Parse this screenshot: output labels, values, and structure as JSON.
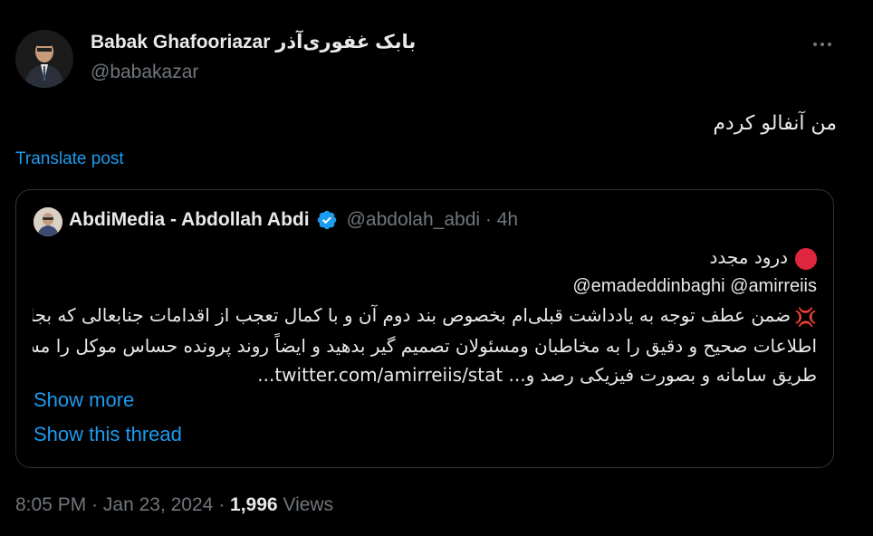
{
  "tweet": {
    "author_name": "Babak Ghafooriazar بابک غفوری‌آذر",
    "author_handle": "@babakazar",
    "text": "من آنفالو کردم",
    "translate_label": "Translate post",
    "time": "8:05 PM",
    "date": "Jan 23, 2024",
    "views_count": "1,996",
    "views_label": "Views",
    "separator": "·"
  },
  "quote": {
    "author_name": "AbdiMedia - Abdollah Abdi",
    "author_handle": "@abdolah_abdi",
    "age": "4h",
    "lines": [
      "درود مجدد",
      "@emadeddinbaghi @amirreiis",
      "ضمن عطف توجه به یادداشت قبلی‌ام بخصوص بند دوم آن و با کمال تعجب از اقدامات جنابعالی که بجای اینکه",
      "اطلاعات صحیح و دقیق را به مخاطبان ومسئولان تصمیم گیر بدهید و ایضاً روند پرونده حساس موکل را مستمرا از",
      "طریق سامانه و بصورت فیزیکی رصد و... twitter.com/amirreiis/stat..."
    ],
    "show_more_label": "Show more",
    "show_thread_label": "Show this thread"
  },
  "icons": {
    "more": "more-dots-icon",
    "verified": "verified-badge-icon",
    "red_circle": "red-circle-emoji-icon",
    "anger": "anger-symbol-emoji-icon"
  },
  "colors": {
    "background": "#000000",
    "text": "#e7e9ea",
    "secondary": "#71767b",
    "link": "#1d9bf0",
    "verified": "#1d9bf0",
    "red": "#e0263f",
    "border": "#2f3336"
  }
}
